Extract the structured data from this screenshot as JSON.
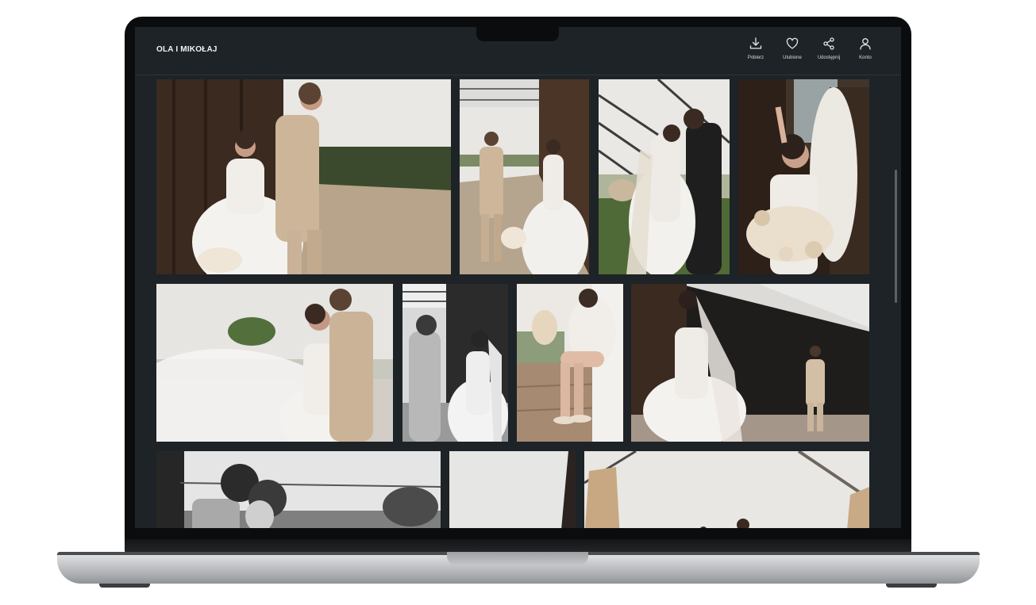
{
  "header": {
    "title": "OLA I MIKOŁAJ",
    "actions": [
      {
        "icon": "download-icon",
        "label": "Pobierz"
      },
      {
        "icon": "heart-icon",
        "label": "Ulubione"
      },
      {
        "icon": "share-icon",
        "label": "Udostępnij"
      },
      {
        "icon": "user-icon",
        "label": "Konto"
      }
    ]
  },
  "gallery": {
    "photos": [
      {
        "name": "photo-couple-barn-wall",
        "scene": "bride and groom by wooden wall",
        "tone": "color"
      },
      {
        "name": "photo-couple-pergola-walk",
        "scene": "couple walking under pergola",
        "tone": "color"
      },
      {
        "name": "photo-couple-embrace-pergola",
        "scene": "couple embrace under pergola",
        "tone": "color"
      },
      {
        "name": "photo-bride-bouquet",
        "scene": "bride holding bouquet",
        "tone": "color"
      },
      {
        "name": "photo-couple-veil-wind",
        "scene": "veil in the wind",
        "tone": "color"
      },
      {
        "name": "photo-couple-bw-dance",
        "scene": "couple holding hands",
        "tone": "bw"
      },
      {
        "name": "photo-bride-shoes",
        "scene": "bride putting on shoes",
        "tone": "color"
      },
      {
        "name": "photo-bride-groom-distance",
        "scene": "bride and groom at barn",
        "tone": "color"
      },
      {
        "name": "photo-couple-bw-closeup",
        "scene": "couple close-up",
        "tone": "bw"
      },
      {
        "name": "photo-sky-detail",
        "scene": "sky and barn edge",
        "tone": "color"
      },
      {
        "name": "photo-curtains-pergola",
        "scene": "curtains under pergola",
        "tone": "color"
      }
    ]
  },
  "colors": {
    "screen_bg": "#1d2327",
    "header_text": "#f2f2f2",
    "icon_stroke": "#e6e8ea"
  }
}
